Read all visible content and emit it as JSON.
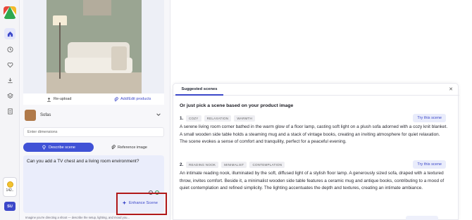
{
  "rail": {
    "credits": "142..",
    "user_initials": "SU"
  },
  "preview": {
    "reupload_label": "Re-upload",
    "add_edit_label": "Add/Edit products"
  },
  "product": {
    "name": "Sofas"
  },
  "dimensions": {
    "placeholder": "Enter dimensions"
  },
  "modes": {
    "describe_label": "Describe scene",
    "reference_label": "Reference image"
  },
  "prompt": {
    "text": "Can you add a TV chest and a living room environment?",
    "enhance_label": "Enhance Scene",
    "hint": "Imagine you're directing a shoot — describe the setup, lighting, and mood you..."
  },
  "scenes_panel": {
    "tab_label": "Suggested scenes",
    "subtitle": "Or just pick a scene based on your product image",
    "try_label": "Try this scene",
    "items": [
      {
        "number": "1.",
        "tags": [
          "COZY",
          "RELAXATION",
          "WARMTH"
        ],
        "description": "A serene living room corner bathed in the warm glow of a floor lamp, casting soft light on a plush sofa adorned with a cozy knit blanket. A small wooden side table holds a steaming mug and a stack of vintage books, creating an inviting atmosphere for quiet relaxation. The scene evokes a sense of comfort and tranquility, perfect for a peaceful evening."
      },
      {
        "number": "2.",
        "tags": [
          "READING NOOK",
          "MINIMALIST",
          "CONTEMPLATION"
        ],
        "description": "An intimate reading nook, illuminated by the soft, diffused light of a stylish floor lamp. A generously sized sofa, draped with a textured throw, invites comfort. Beside it, a minimalist wooden side table features a ceramic mug and antique books, contributing to a mood of quiet contemplation and refined simplicity. The lighting accentuates the depth and textures, creating an intimate ambiance."
      }
    ]
  },
  "colors": {
    "accent": "#3b47c9",
    "highlight_box": "#b01818"
  }
}
